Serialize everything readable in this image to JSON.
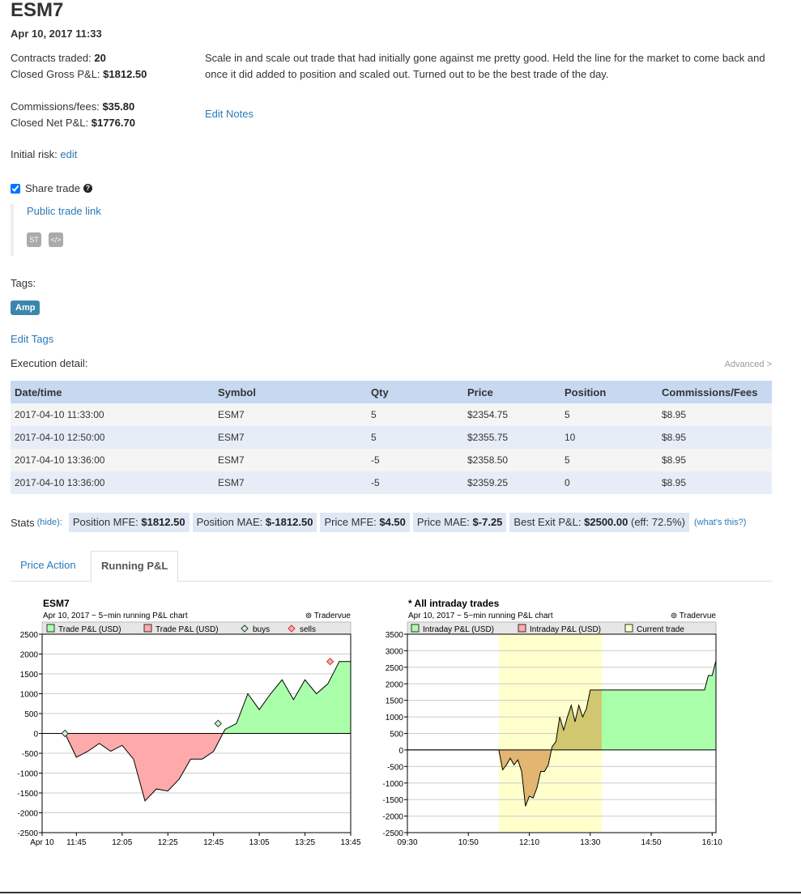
{
  "trade": {
    "symbol": "ESM7",
    "datetime": "Apr 10, 2017 11:33",
    "contracts_label": "Contracts traded:",
    "contracts_value": "20",
    "gross_label": "Closed Gross P&L:",
    "gross_value": "$1812.50",
    "comm_label": "Commissions/fees:",
    "comm_value": "$35.80",
    "net_label": "Closed Net P&L:",
    "net_value": "$1776.70",
    "notes": "Scale in and scale out trade that had initially gone against me pretty good. Held the line for the market to come back and once it did added to position and scaled out. Turned out to be the best trade of the day.",
    "edit_notes": "Edit Notes",
    "initial_risk_label": "Initial risk:",
    "initial_risk_link": "edit",
    "share_label": "Share trade",
    "share_checked": true,
    "public_link": "Public trade link",
    "st_icon_label": "ST",
    "embed_icon_label": "</>",
    "tags_label": "Tags:",
    "tags": [
      "Amp"
    ],
    "edit_tags": "Edit Tags",
    "exec_label": "Execution detail:",
    "advanced": "Advanced >"
  },
  "executions": {
    "headers": [
      "Date/time",
      "Symbol",
      "Qty",
      "Price",
      "Position",
      "Commissions/Fees"
    ],
    "rows": [
      [
        "2017-04-10 11:33:00",
        "ESM7",
        "5",
        "$2354.75",
        "5",
        "$8.95"
      ],
      [
        "2017-04-10 12:50:00",
        "ESM7",
        "5",
        "$2355.75",
        "10",
        "$8.95"
      ],
      [
        "2017-04-10 13:36:00",
        "ESM7",
        "-5",
        "$2358.50",
        "5",
        "$8.95"
      ],
      [
        "2017-04-10 13:36:00",
        "ESM7",
        "-5",
        "$2359.25",
        "0",
        "$8.95"
      ]
    ]
  },
  "stats": {
    "label": "Stats",
    "hide": "(hide):",
    "mfe_label": "Position MFE:",
    "mfe_value": "$1812.50",
    "mae_label": "Position MAE:",
    "mae_value": "$-1812.50",
    "pmfe_label": "Price MFE:",
    "pmfe_value": "$4.50",
    "pmae_label": "Price MAE:",
    "pmae_value": "$-7.25",
    "best_label": "Best Exit P&L:",
    "best_value": "$2500.00",
    "best_eff": "(eff: 72.5%)",
    "whats": "(what's this?)"
  },
  "tabs": [
    {
      "label": "Price Action",
      "active": false
    },
    {
      "label": "Running P&L",
      "active": true
    }
  ],
  "chart_data": [
    {
      "type": "area",
      "title": "ESM7",
      "subtitle": "Apr 10, 2017 − 5−min running P&L chart",
      "brand": "⊚ Tradervue",
      "legend": [
        "Trade P&L (USD)",
        "Trade P&L (USD)",
        "buys",
        "sells"
      ],
      "colors": {
        "pos": "#aaffaa",
        "neg": "#ffaaaa",
        "buy": "#ccffcc",
        "sell": "#ffaaaa"
      },
      "x_ticks": [
        "Apr 10",
        "11:45",
        "12:05",
        "12:25",
        "12:45",
        "13:05",
        "13:25",
        "13:45"
      ],
      "x_tick_minutes": [
        690,
        705,
        725,
        745,
        765,
        785,
        805,
        825
      ],
      "xlim_minutes": [
        690,
        825
      ],
      "ylim": [
        -2500,
        2500
      ],
      "y_ticks": [
        -2500,
        -2000,
        -1500,
        -1000,
        -500,
        0,
        500,
        1000,
        1500,
        2000,
        2500
      ],
      "x_minutes": [
        690,
        700,
        705,
        710,
        715,
        720,
        725,
        730,
        735,
        740,
        745,
        750,
        755,
        760,
        765,
        770,
        775,
        780,
        785,
        790,
        795,
        800,
        805,
        810,
        815,
        820,
        825
      ],
      "y": [
        0,
        0,
        -600,
        -450,
        -250,
        -450,
        -300,
        -650,
        -1700,
        -1400,
        -1450,
        -1150,
        -650,
        -650,
        -450,
        100,
        250,
        1000,
        600,
        1000,
        1350,
        850,
        1350,
        1000,
        1250,
        1812.5,
        1812.5
      ],
      "buys": [
        {
          "x": 700,
          "y": 0
        },
        {
          "x": 767,
          "y": 250
        }
      ],
      "sells": [
        {
          "x": 816,
          "y": 1812.5
        }
      ]
    },
    {
      "type": "area",
      "title": "* All intraday trades",
      "subtitle": "Apr 10, 2017 − 5−min running P&L chart",
      "brand": "⊚ Tradervue",
      "legend": [
        "Intraday P&L (USD)",
        "Intraday P&L (USD)",
        "Current trade"
      ],
      "colors": {
        "pos": "#aaffaa",
        "neg": "#ffaaaa",
        "current": "#ffffcc"
      },
      "x_ticks": [
        "09:30",
        "10:50",
        "12:10",
        "13:30",
        "14:50",
        "16:10"
      ],
      "x_tick_minutes": [
        570,
        650,
        730,
        810,
        890,
        970
      ],
      "xlim_minutes": [
        570,
        975
      ],
      "ylim": [
        -2500,
        3500
      ],
      "y_ticks": [
        -2500,
        -2000,
        -1500,
        -1000,
        -500,
        0,
        500,
        1000,
        1500,
        2000,
        2500,
        3000,
        3500
      ],
      "current_trade_minutes": [
        690,
        825
      ],
      "x_minutes": [
        570,
        690,
        695,
        700,
        705,
        710,
        715,
        720,
        725,
        730,
        735,
        740,
        745,
        750,
        755,
        760,
        765,
        770,
        775,
        780,
        785,
        790,
        795,
        800,
        805,
        810,
        815,
        820,
        825,
        960,
        965,
        970,
        975
      ],
      "y": [
        0,
        0,
        -600,
        -450,
        -250,
        -450,
        -300,
        -650,
        -1700,
        -1400,
        -1450,
        -1150,
        -650,
        -650,
        -450,
        100,
        250,
        1000,
        600,
        1000,
        1350,
        850,
        1350,
        1000,
        1250,
        1812.5,
        1812.5,
        1812.5,
        1812.5,
        1812.5,
        2250,
        2250,
        2700
      ]
    }
  ]
}
